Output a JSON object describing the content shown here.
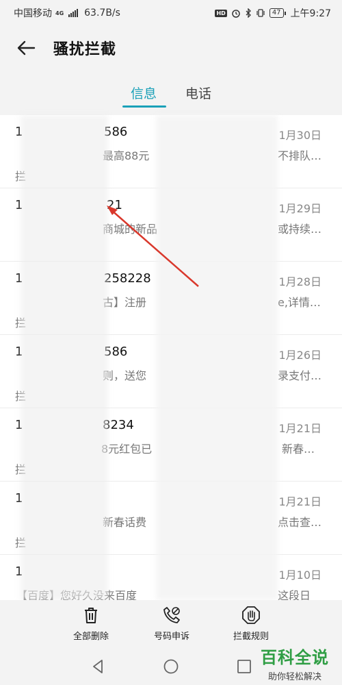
{
  "status_bar": {
    "carrier": "中国移动",
    "network": "4G",
    "speed": "63.7B/s",
    "hd": "HD",
    "battery": "47",
    "time": "上午9:27"
  },
  "header": {
    "title": "骚扰拦截"
  },
  "tabs": [
    {
      "label": "信息",
      "active": true
    },
    {
      "label": "电话",
      "active": false
    }
  ],
  "messages": [
    {
      "sender_prefix": "1",
      "sender_visible": "586",
      "date": "1月30日",
      "preview_visible": "最高88元",
      "preview_tail": "不排队…",
      "line2": "拦"
    },
    {
      "sender_prefix": "1",
      "sender_visible": "21",
      "date": "1月29日",
      "preview_visible": "商城的新品",
      "preview_tail": "或持续…",
      "line2": ""
    },
    {
      "sender_prefix": "1",
      "sender_visible": "258228",
      "date": "1月28日",
      "preview_visible": "古】注册",
      "preview_tail": "e,详情…",
      "line2": "拦"
    },
    {
      "sender_prefix": "1",
      "sender_visible": "586",
      "date": "1月26日",
      "preview_visible": "则，送您",
      "preview_tail": "录支付…",
      "line2": "拦"
    },
    {
      "sender_prefix": "1",
      "sender_visible": "8234",
      "date": "1月21日",
      "preview_visible": "8元红包已",
      "preview_tail": "新春…",
      "line2": "拦"
    },
    {
      "sender_prefix": "1",
      "sender_visible": "",
      "date": "1月21日",
      "preview_visible": "新春话费",
      "preview_tail": "点击查…",
      "line2": "拦"
    },
    {
      "sender_prefix": "1",
      "sender_visible": "",
      "date": "1月10日",
      "preview_visible": "【百度】您好久没来百度",
      "preview_tail": "这段日",
      "line2": ""
    }
  ],
  "toolbar": {
    "delete_all": "全部删除",
    "report_number": "号码申诉",
    "block_rules": "拦截规则"
  },
  "watermark": {
    "title": "百科全说",
    "subtitle": "助你轻松解决"
  },
  "accent_color": "#1aa0b8",
  "icons": [
    "back-arrow-icon",
    "trash-icon",
    "phone-block-icon",
    "hand-shield-icon",
    "nav-back-icon",
    "nav-home-icon",
    "nav-recent-icon"
  ]
}
